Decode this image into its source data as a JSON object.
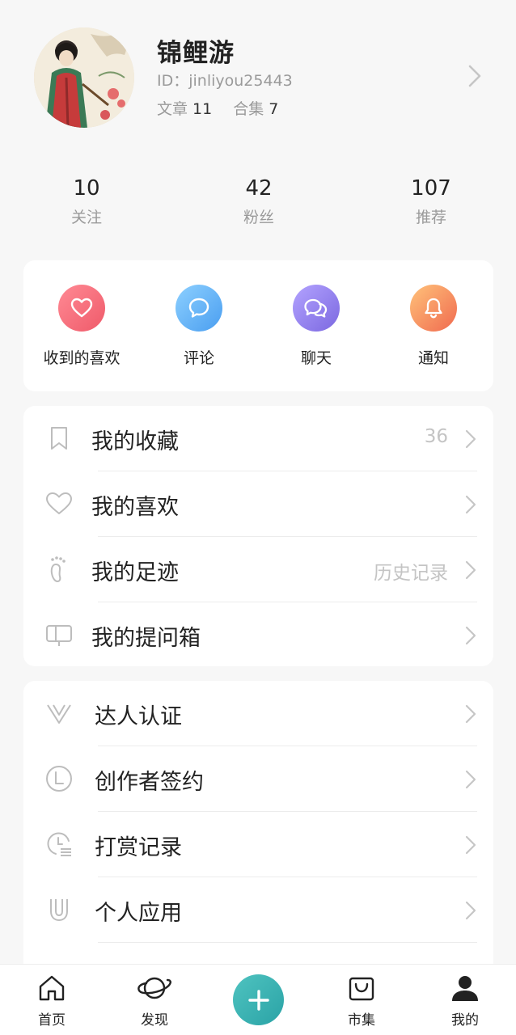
{
  "profile": {
    "name": "锦鲤游",
    "id": "ID：jinliyou25443",
    "articles_label": "文章",
    "articles_count": "11",
    "collections_label": "合集",
    "collections_count": "7"
  },
  "stats": [
    {
      "value": "10",
      "label": "关注"
    },
    {
      "value": "42",
      "label": "粉丝"
    },
    {
      "value": "107",
      "label": "推荐"
    }
  ],
  "quick_actions": [
    {
      "label": "收到的喜欢",
      "icon": "heart-icon",
      "color": "#f1606e"
    },
    {
      "label": "评论",
      "icon": "comment-icon",
      "color": "#56a8f5"
    },
    {
      "label": "聊天",
      "icon": "chat-icon",
      "color": "#8a76e8"
    },
    {
      "label": "通知",
      "icon": "bell-icon",
      "color": "#f7894e"
    }
  ],
  "menu_group1": [
    {
      "label": "我的收藏",
      "value": "36",
      "icon": "bookmark-icon"
    },
    {
      "label": "我的喜欢",
      "value": "",
      "icon": "heart-outline-icon"
    },
    {
      "label": "我的足迹",
      "value": "历史记录",
      "icon": "footprint-icon"
    },
    {
      "label": "我的提问箱",
      "value": "",
      "icon": "question-box-icon"
    }
  ],
  "menu_group2": [
    {
      "label": "达人认证",
      "icon": "verified-v-icon"
    },
    {
      "label": "创作者签约",
      "icon": "contract-icon"
    },
    {
      "label": "打赏记录",
      "icon": "reward-record-icon"
    },
    {
      "label": "个人应用",
      "icon": "magnet-app-icon"
    }
  ],
  "bottom_nav": {
    "home": "首页",
    "discover": "发现",
    "market": "市集",
    "mine": "我的"
  }
}
